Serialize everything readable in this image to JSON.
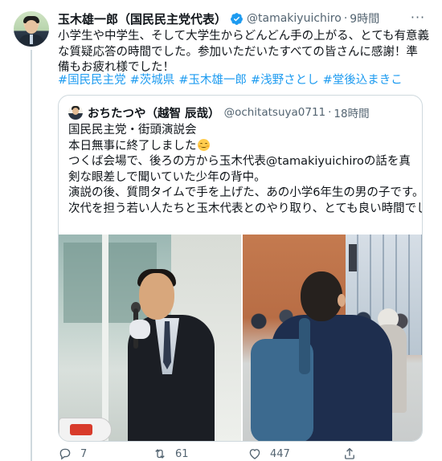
{
  "tweet": {
    "author_name": "玉木雄一郎（国民民主党代表）",
    "handle": "@tamakiyuichiro",
    "separator": "·",
    "time": "9時間",
    "more_label": "···",
    "text": "小学生や中学生、そして大学生からどんどん手の上がる、とても有意義な質疑応答の時間でした。参加いただいたすべての皆さんに感謝！準備もお疲れ様でした！",
    "hashtags": [
      "#国民民主党",
      "#茨城県",
      "#玉木雄一郎",
      "#浅野さとし",
      "#堂後込まきこ"
    ]
  },
  "quote": {
    "author_name": "おちたつや（越智 辰哉）",
    "handle": "@ochitatsuya0711",
    "separator": "·",
    "time": "18時間",
    "lines": [
      "国民民主党・街頭演説会",
      "本日無事に終了しました",
      "つくば会場で、後ろの方から玉木代表@tamakiyuichiroの話を真剣な眼差しで聞いていた少年の背中。",
      "演説の後、質問タイムで手を上げた、あの小学6年生の男の子です。",
      "次代を担う若い人たちと玉木代表とのやり取り、とても良い時間でした。"
    ],
    "emoji": "grinning-face-emoji"
  },
  "actions": {
    "reply_count": "7",
    "retweet_count": "61",
    "like_count": "447"
  },
  "colors": {
    "link": "#1d9bf0",
    "text": "#0f1419",
    "secondary": "#536471",
    "border": "#cfd9de"
  }
}
